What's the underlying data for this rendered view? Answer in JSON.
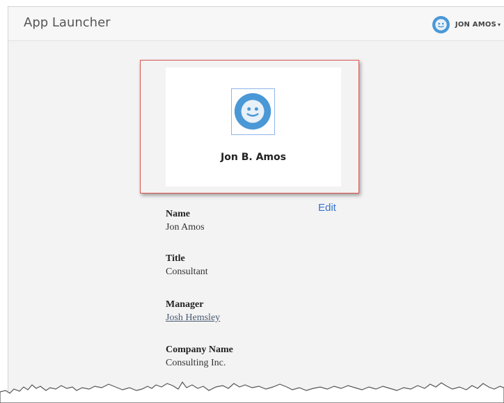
{
  "header": {
    "app_title": "App Launcher",
    "user_name": "JON AMOS",
    "caret": "▾",
    "avatar_icon": "smiley-avatar-icon"
  },
  "profile": {
    "display_name": "Jon B. Amos",
    "avatar_icon": "smiley-avatar-icon"
  },
  "details": {
    "edit_label": "Edit",
    "fields": [
      {
        "label": "Name",
        "value": "Jon Amos"
      },
      {
        "label": "Title",
        "value": "Consultant"
      },
      {
        "label": "Manager",
        "value": "Josh Hemsley"
      },
      {
        "label": "Company Name",
        "value": "Consulting Inc."
      }
    ]
  },
  "colors": {
    "avatar_blue": "#4a98d6",
    "highlight": "#d9534f",
    "link": "#3573c9"
  }
}
